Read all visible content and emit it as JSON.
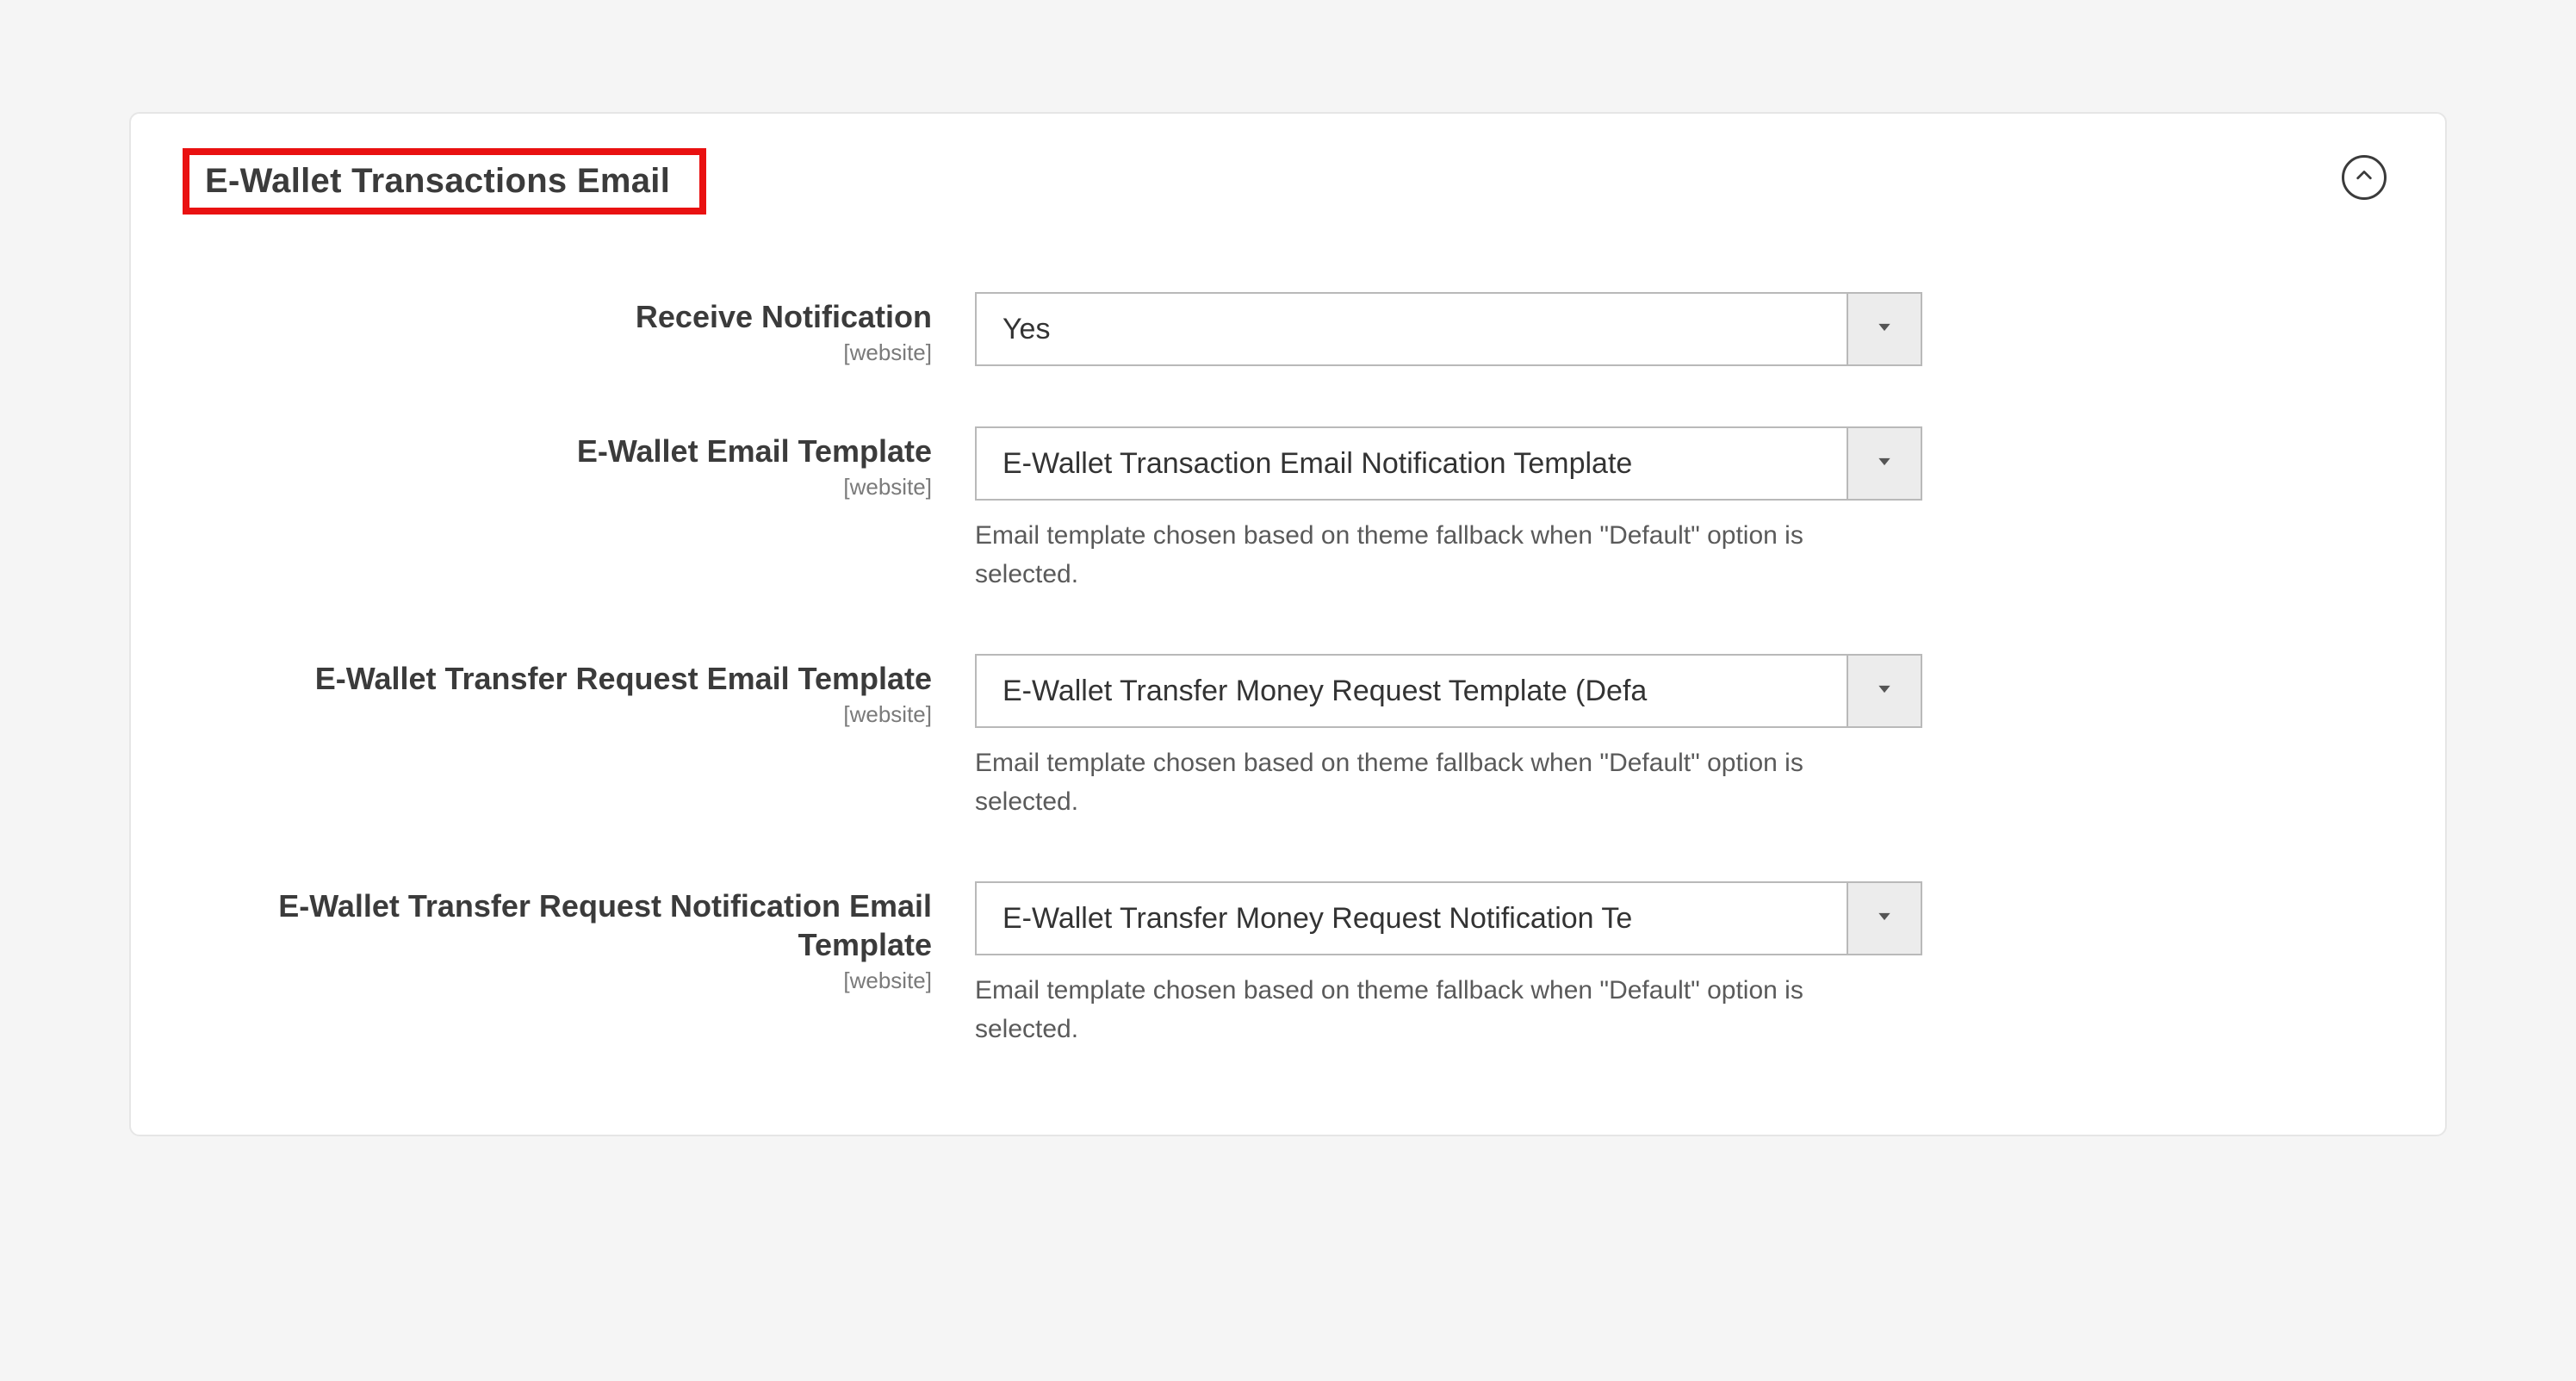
{
  "section": {
    "title": "E-Wallet Transactions Email",
    "scope_label": "[website]"
  },
  "fields": {
    "receive_notification": {
      "label": "Receive Notification",
      "value": "Yes"
    },
    "email_template": {
      "label": "E-Wallet Email Template",
      "value": "E-Wallet Transaction Email Notification Template",
      "help": "Email template chosen based on theme fallback when \"Default\" option is selected."
    },
    "transfer_request_template": {
      "label": "E-Wallet Transfer Request Email Template",
      "value": "E-Wallet Transfer Money Request Template (Defa",
      "help": "Email template chosen based on theme fallback when \"Default\" option is selected."
    },
    "transfer_request_notification_template": {
      "label": "E-Wallet Transfer Request Notification Email Template",
      "value": "E-Wallet Transfer Money Request Notification Te",
      "help": "Email template chosen based on theme fallback when \"Default\" option is selected."
    }
  }
}
